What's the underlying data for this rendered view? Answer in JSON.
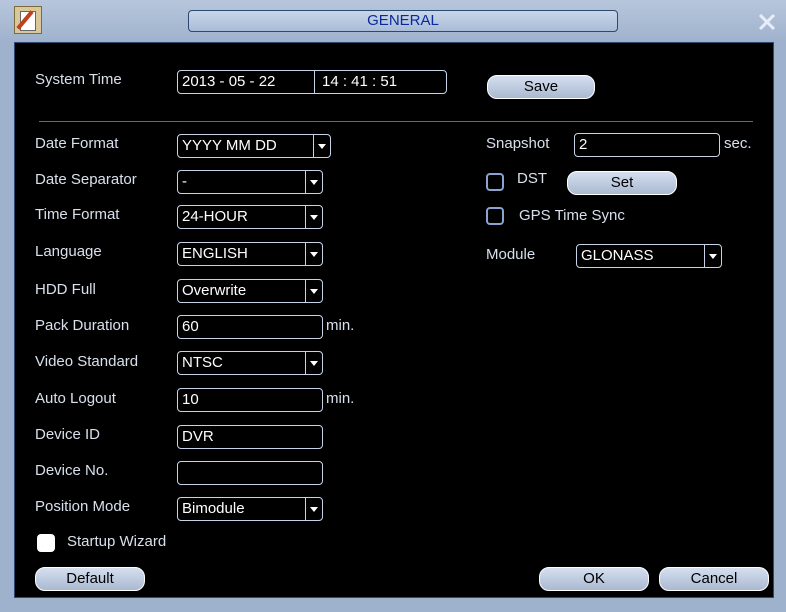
{
  "title": "GENERAL",
  "system_time": {
    "label": "System Time",
    "date": "2013 - 05 - 22",
    "time": "14 : 41 : 51",
    "save_label": "Save"
  },
  "left": {
    "date_format": {
      "label": "Date Format",
      "value": "YYYY MM DD"
    },
    "date_separator": {
      "label": "Date Separator",
      "value": "-"
    },
    "time_format": {
      "label": "Time Format",
      "value": "24-HOUR"
    },
    "language": {
      "label": "Language",
      "value": "ENGLISH"
    },
    "hdd_full": {
      "label": "HDD Full",
      "value": "Overwrite"
    },
    "pack_duration": {
      "label": "Pack Duration",
      "value": "60",
      "unit": "min."
    },
    "video_standard": {
      "label": "Video Standard",
      "value": "NTSC"
    },
    "auto_logout": {
      "label": "Auto Logout",
      "value": "10",
      "unit": "min."
    },
    "device_id": {
      "label": "Device ID",
      "value": "DVR"
    },
    "device_no": {
      "label": "Device No.",
      "value": ""
    },
    "position_mode": {
      "label": "Position Mode",
      "value": "Bimodule"
    }
  },
  "right": {
    "snapshot": {
      "label": "Snapshot",
      "value": "2",
      "unit": "sec."
    },
    "dst": {
      "label": "DST",
      "checked": false,
      "set_label": "Set"
    },
    "gps_time_sync": {
      "label": "GPS Time Sync",
      "checked": false
    },
    "module": {
      "label": "Module",
      "value": "GLONASS"
    }
  },
  "startup_wizard": {
    "label": "Startup Wizard",
    "checked": true
  },
  "buttons": {
    "default": "Default",
    "ok": "OK",
    "cancel": "Cancel"
  },
  "icons": {
    "app": "settings-sheet-icon",
    "close": "close-icon"
  },
  "colors": {
    "frame": "#9fb2cd",
    "title_text": "#0a2a9a",
    "divider": "#2b76c9",
    "panel": "#000000"
  }
}
